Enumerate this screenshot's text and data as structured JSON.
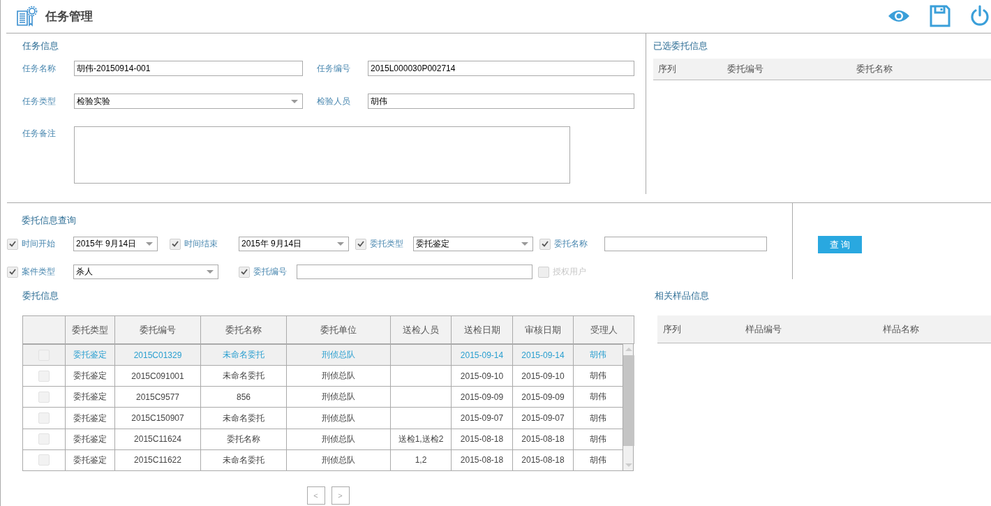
{
  "header": {
    "title": "任务管理"
  },
  "task_info": {
    "title": "任务信息",
    "fields": [
      {
        "label": "任务名称",
        "kind": "text",
        "value": "胡伟-20150914-001"
      },
      {
        "label": "任务编号",
        "kind": "text",
        "value": "2015L000030P002714"
      },
      {
        "label": "任务类型",
        "kind": "select",
        "value": "检验实验"
      },
      {
        "label": "检验人员",
        "kind": "text",
        "value": "胡伟"
      },
      {
        "label": "任务备注",
        "kind": "textarea"
      }
    ]
  },
  "selected_panel": {
    "title": "已选委托信息",
    "columns": [
      "序列",
      "委托编号",
      "委托名称"
    ]
  },
  "query": {
    "title": "委托信息查询",
    "filters": [
      {
        "label": "时间开始",
        "checked": true,
        "disabled": false,
        "kind": "date",
        "value": "2015年 9月14日"
      },
      {
        "label": "时间结束",
        "checked": true,
        "disabled": false,
        "kind": "date",
        "value": "2015年 9月14日"
      },
      {
        "label": "委托类型",
        "checked": true,
        "disabled": false,
        "kind": "select",
        "value": "委托鉴定"
      },
      {
        "label": "委托名称",
        "checked": true,
        "disabled": false,
        "kind": "text"
      },
      {
        "label": "案件类型",
        "checked": true,
        "disabled": false,
        "kind": "select",
        "value": "杀人"
      },
      {
        "label": "委托编号",
        "checked": true,
        "disabled": false,
        "kind": "text"
      },
      {
        "label": "授权用户",
        "checked": false,
        "disabled": true,
        "kind": "checkbox"
      }
    ],
    "button": "查 询"
  },
  "commissions": {
    "title": "委托信息",
    "columns": [
      "委托类型",
      "委托编号",
      "委托名称",
      "委托单位",
      "送检人员",
      "送检日期",
      "审核日期",
      "受理人"
    ],
    "rows": [
      {
        "selected": true,
        "checked": false,
        "cells": [
          "委托鉴定",
          "2015C01329",
          "未命名委托",
          "刑侦总队",
          "",
          "2015-09-14",
          "2015-09-14",
          "胡伟"
        ]
      },
      {
        "selected": false,
        "checked": false,
        "cells": [
          "委托鉴定",
          "2015C091001",
          "未命名委托",
          "刑侦总队",
          "",
          "2015-09-10",
          "2015-09-10",
          "胡伟"
        ]
      },
      {
        "selected": false,
        "checked": false,
        "cells": [
          "委托鉴定",
          "2015C9577",
          "856",
          "刑侦总队",
          "",
          "2015-09-09",
          "2015-09-09",
          "胡伟"
        ]
      },
      {
        "selected": false,
        "checked": false,
        "cells": [
          "委托鉴定",
          "2015C150907",
          "未命名委托",
          "刑侦总队",
          "",
          "2015-09-07",
          "2015-09-07",
          "胡伟"
        ]
      },
      {
        "selected": false,
        "checked": false,
        "cells": [
          "委托鉴定",
          "2015C11624",
          "委托名称",
          "刑侦总队",
          "送检1,送检2",
          "2015-08-18",
          "2015-08-18",
          "胡伟"
        ]
      },
      {
        "selected": false,
        "checked": false,
        "cells": [
          "委托鉴定",
          "2015C11622",
          "未命名委托",
          "刑侦总队",
          "1,2",
          "2015-08-18",
          "2015-08-18",
          "胡伟"
        ]
      }
    ],
    "pager": {
      "prev": "<",
      "next": ">"
    }
  },
  "samples": {
    "title": "相关样品信息",
    "columns": [
      "序列",
      "样品编号",
      "样品名称"
    ]
  }
}
